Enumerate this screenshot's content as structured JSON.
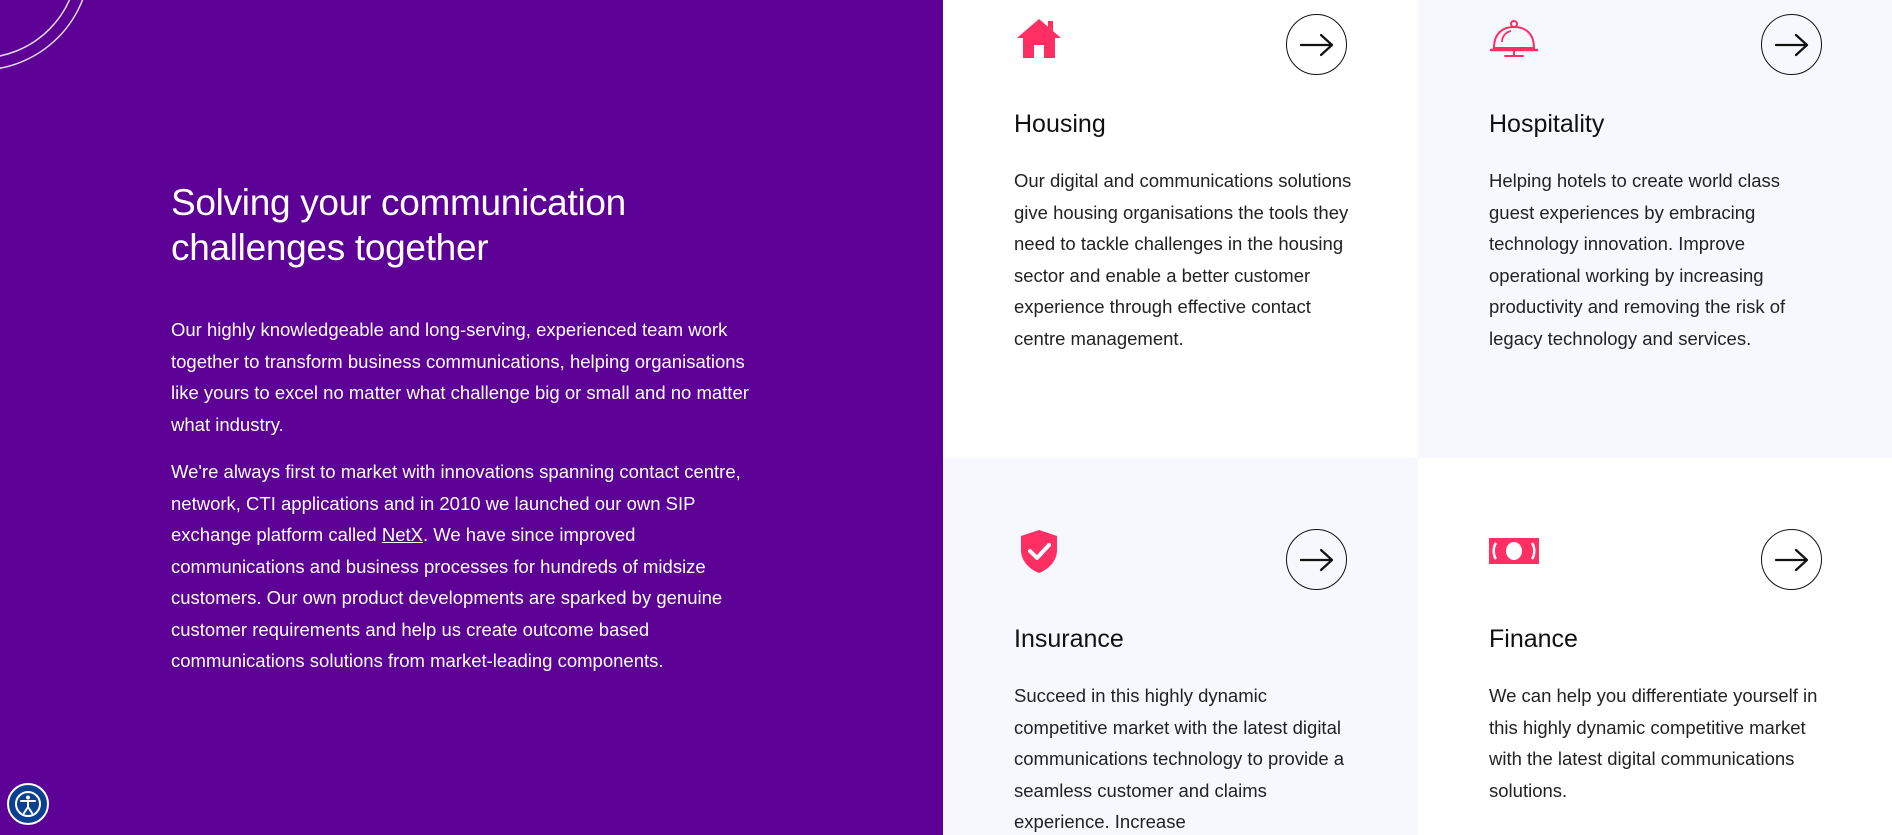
{
  "intro": {
    "headline": "Solving your communication challenges together",
    "paragraph_1": "Our highly knowledgeable and long-serving, experienced team work together to transform business communications, helping organisations like yours to excel no matter what challenge big or small and no matter what industry.",
    "paragraph_2_before": "We're always first to market with innovations spanning contact centre, network, CTI applications and in 2010 we launched our own SIP exchange platform called ",
    "paragraph_2_link": "NetX",
    "paragraph_2_after": ". We have since improved communications and business processes for hundreds of midsize customers. Our own product developments are sparked by genuine customer requirements and help us create outcome based communications solutions from market-leading components."
  },
  "sectors": [
    {
      "title": "Housing",
      "icon": "house-icon",
      "description": "Our digital and communications solutions give housing organisations the tools they need to tackle challenges in the housing sector and enable a better customer experience through effective contact centre management."
    },
    {
      "title": "Hospitality",
      "icon": "service-bell-icon",
      "description": "Helping hotels to create world class guest experiences by embracing technology innovation. Improve operational working by increasing productivity and removing the risk of legacy technology and services."
    },
    {
      "title": "Insurance",
      "icon": "shield-check-icon",
      "description": "Succeed in this highly dynamic competitive market with the latest digital communications technology to provide a seamless customer and claims experience. Increase"
    },
    {
      "title": "Finance",
      "icon": "banknote-icon",
      "description": "We can help you differentiate yourself in this highly dynamic competitive market with the latest digital communications solutions."
    }
  ],
  "colors": {
    "brand_purple": "#5c0096",
    "accent_pink": "#ff2e63",
    "card_alt_bg": "#f6f8fd",
    "accessibility_blue": "#0b3f8f"
  },
  "accessibility_button_icon": "accessibility-icon"
}
